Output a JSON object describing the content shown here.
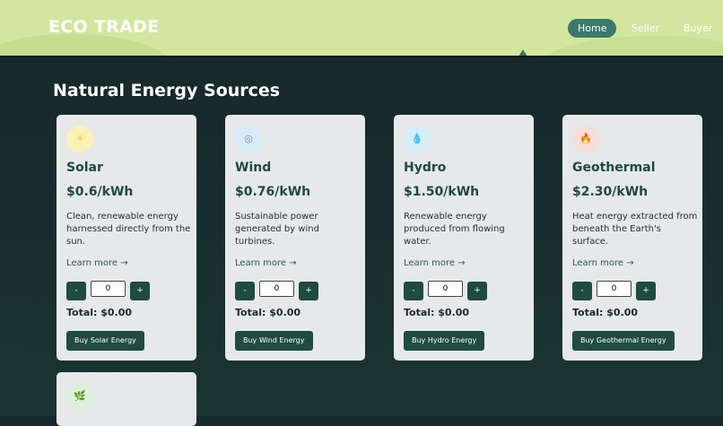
{
  "header": {
    "brand": "ECO TRADE",
    "nav": [
      {
        "label": "Home"
      },
      {
        "label": "Seller"
      },
      {
        "label": "Buyer"
      }
    ]
  },
  "main": {
    "title": "Natural Energy Sources",
    "cards": [
      {
        "icon": "sun-icon",
        "name": "Solar",
        "price": "$0.6/kWh",
        "description": "Clean, renewable energy harnessed directly from the sun.",
        "learn_more": "Learn more →",
        "minus": "-",
        "plus": "+",
        "quantity": "0",
        "total": "Total: $0.00",
        "buy": "Buy Solar Energy"
      },
      {
        "icon": "wind-icon",
        "name": "Wind",
        "price": "$0.76/kWh",
        "description": "Sustainable power generated by wind turbines.",
        "learn_more": "Learn more →",
        "minus": "-",
        "plus": "+",
        "quantity": "0",
        "total": "Total: $0.00",
        "buy": "Buy Wind Energy"
      },
      {
        "icon": "water-drop-icon",
        "name": "Hydro",
        "price": "$1.50/kWh",
        "description": "Renewable energy produced from flowing water.",
        "learn_more": "Learn more →",
        "minus": "-",
        "plus": "+",
        "quantity": "0",
        "total": "Total: $0.00",
        "buy": "Buy Hydro Energy"
      },
      {
        "icon": "fire-icon",
        "name": "Geothermal",
        "price": "$2.30/kWh",
        "description": "Heat energy extracted from beneath the Earth's surface.",
        "learn_more": "Learn more →",
        "minus": "-",
        "plus": "+",
        "quantity": "0",
        "total": "Total: $0.00",
        "buy": "Buy Geothermal Energy"
      }
    ],
    "partial_card": {
      "icon": "leaf-icon"
    }
  }
}
